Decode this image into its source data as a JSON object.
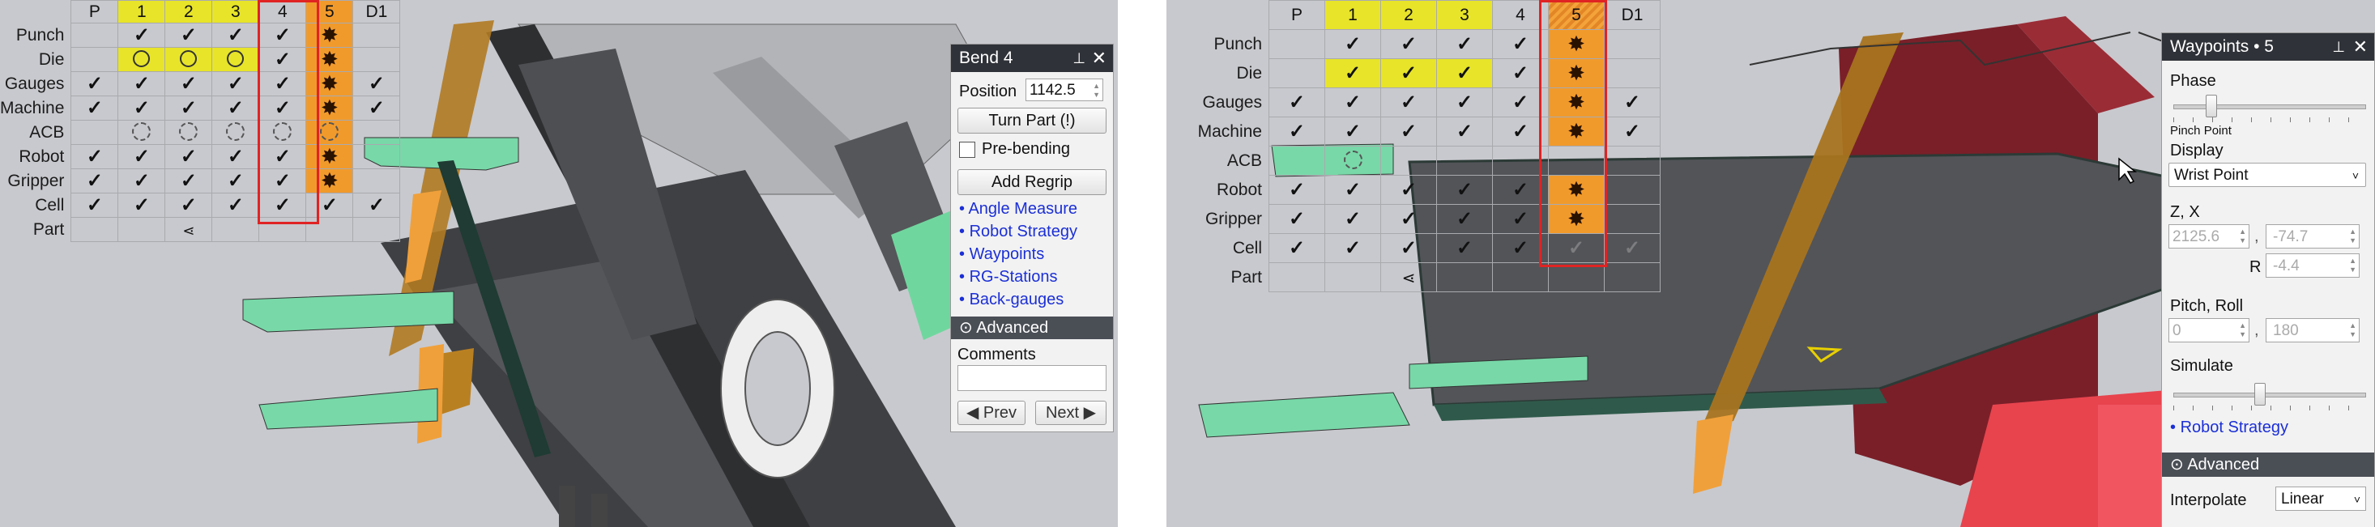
{
  "grid_rows": [
    "Punch",
    "Die",
    "Gauges",
    "Machine",
    "ACB",
    "Robot",
    "Gripper",
    "Cell",
    "Part"
  ],
  "grid_cols": [
    "P",
    "1",
    "2",
    "3",
    "4",
    "5",
    "D1"
  ],
  "left_dialog": {
    "title": "Bend 4",
    "pin_icon": "pin-icon",
    "close_icon": "close-icon",
    "position_label": "Position",
    "position_value": "1142.5",
    "turn_part": "Turn Part (!)",
    "pre_bending": "Pre-bending",
    "add_regrip": "Add Regrip",
    "links": [
      "Angle Measure",
      "Robot Strategy",
      "Waypoints",
      "RG-Stations",
      "Back-gauges"
    ],
    "advanced": "Advanced",
    "comments_label": "Comments",
    "prev": "Prev",
    "next": "Next"
  },
  "right_dialog": {
    "title": "Waypoints • 5",
    "phase": "Phase",
    "phase_caption": "Pinch Point",
    "display": "Display",
    "display_value": "Wrist Point",
    "zx": "Z, X",
    "z_value": "2125.6",
    "x_value": "-74.7",
    "r_label": "R",
    "r_value": "-4.4",
    "pitch_roll": "Pitch, Roll",
    "pitch_value": "0",
    "roll_value": "180",
    "comma": ",",
    "simulate": "Simulate",
    "robot_strategy": "Robot Strategy",
    "advanced": "Advanced",
    "interpolate": "Interpolate",
    "interpolate_value": "Linear"
  },
  "colors": {
    "viewport": "#c8c9ce",
    "highlight_yellow": "#e7e42a",
    "highlight_orange": "#f19a2c",
    "selection_red": "#e02323",
    "link_blue": "#1b2fd6",
    "gripper_green": "#78d8a8"
  }
}
